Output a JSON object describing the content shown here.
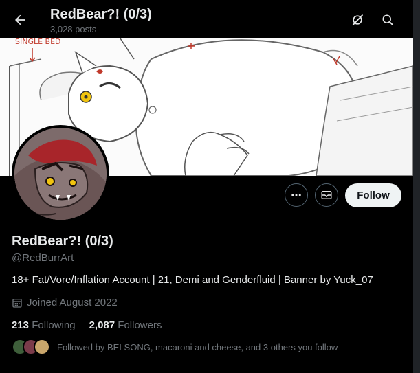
{
  "header": {
    "title": "RedBear?! (0/3)",
    "post_count": "3,028 posts",
    "back_icon": "arrow-left-icon",
    "grok_icon": "grok-slash-icon",
    "search_icon": "search-icon"
  },
  "banner": {
    "annotation": "SINGLE BED",
    "description_icon": "sketch-artwork"
  },
  "actions": {
    "more_icon": "more-dots-icon",
    "message_icon": "mail-icon",
    "follow_label": "Follow"
  },
  "profile": {
    "name": "RedBear?! (0/3)",
    "handle": "@RedBurrArt",
    "bio": "18+ Fat/Vore/Inflation Account | 21, Demi and Genderfluid | Banner by Yuck_07",
    "joined": "Joined August 2022",
    "joined_icon": "calendar-icon"
  },
  "stats": {
    "following_count": "213",
    "following_label": "Following",
    "followers_count": "2,087",
    "followers_label": "Followers"
  },
  "followed_by": {
    "text": "Followed by BELSONG, macaroni and cheese, and 3 others you follow"
  },
  "colors": {
    "background": "#000000",
    "text_primary": "#e7e9ea",
    "text_secondary": "#71767b",
    "follow_button_bg": "#eff3f4",
    "border": "#536471"
  }
}
